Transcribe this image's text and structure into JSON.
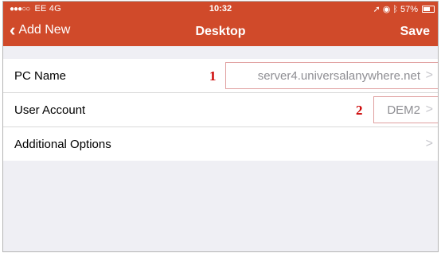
{
  "status_bar": {
    "carrier": "EE 4G",
    "time": "10:32",
    "battery": "57%",
    "battery_level": 0.57
  },
  "nav": {
    "back_label": "Add New",
    "title": "Desktop",
    "save_label": "Save",
    "color": "#d04a2a"
  },
  "rows": [
    {
      "label": "PC Name",
      "value": "server4.universalanywhere.net"
    },
    {
      "label": "User Account",
      "value": "DEM2"
    },
    {
      "label": "Additional Options",
      "value": ""
    }
  ],
  "annotations": [
    "1",
    "2"
  ],
  "icons": {
    "back": "chevron-left-icon",
    "disclosure": "chevron-right-icon",
    "location": "location-arrow-icon",
    "alarm": "alarm-icon",
    "bluetooth": "bluetooth-icon",
    "battery": "battery-icon"
  }
}
